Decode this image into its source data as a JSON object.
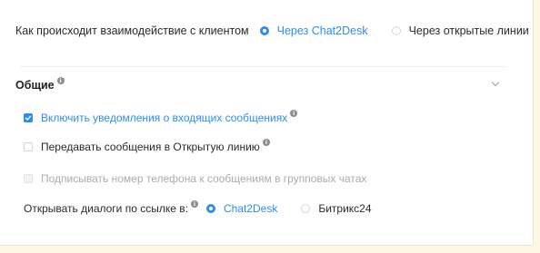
{
  "interaction": {
    "question": "Как происходит взаимодействие с клиентом",
    "options": [
      {
        "label": "Через Chat2Desk",
        "selected": true
      },
      {
        "label": "Через открытые линии",
        "selected": false
      }
    ]
  },
  "section": {
    "title": "Общие",
    "info_glyph": "i",
    "expanded": true
  },
  "settings": [
    {
      "label": "Включить уведомления о входящих сообщениях",
      "checked": true,
      "disabled": false,
      "has_info": true
    },
    {
      "label": "Передавать сообщения в Открытую линию",
      "checked": false,
      "disabled": false,
      "has_info": true
    },
    {
      "label": "Подписывать номер телефона к сообщениям в групповых чатах",
      "checked": false,
      "disabled": true,
      "has_info": false
    }
  ],
  "open_dialogs": {
    "question": "Открывать диалоги по ссылке в:",
    "options": [
      {
        "label": "Chat2Desk",
        "selected": true
      },
      {
        "label": "Битрикс24",
        "selected": false
      }
    ]
  },
  "colors": {
    "accent": "#2d8cf0",
    "background": "#fdf7e4",
    "panel": "#ffffff",
    "disabled_text": "#a9acb0"
  }
}
